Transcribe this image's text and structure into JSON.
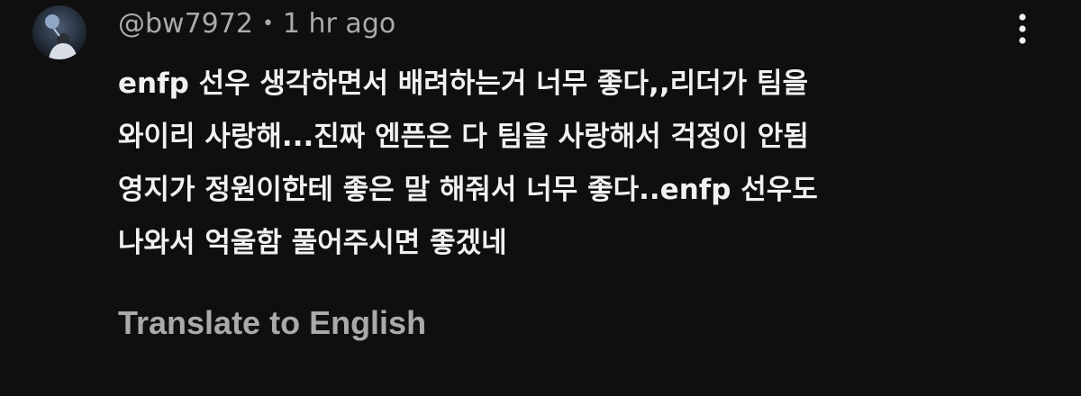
{
  "comment": {
    "author": "@bw7972",
    "separator": "•",
    "timestamp": "1 hr ago",
    "avatar_icon": "user-avatar",
    "menu_icon": "more-vertical-icon",
    "body_lines": [
      "enfp 선우 생각하면서 배려하는거 너무 좋다,,리더가 팀을",
      "와이리 사랑해...진짜 엔픈은 다 팀을 사랑해서 걱정이 안됨",
      "영지가 정원이한테 좋은 말 해줘서 너무 좋다..enfp 선우도",
      "나와서 억울함 풀어주시면 좋겠네"
    ],
    "translate_label": "Translate to English"
  },
  "colors": {
    "background": "#0f0f0f",
    "primary_text": "#f1f1f1",
    "secondary_text": "#aaaaaa"
  }
}
